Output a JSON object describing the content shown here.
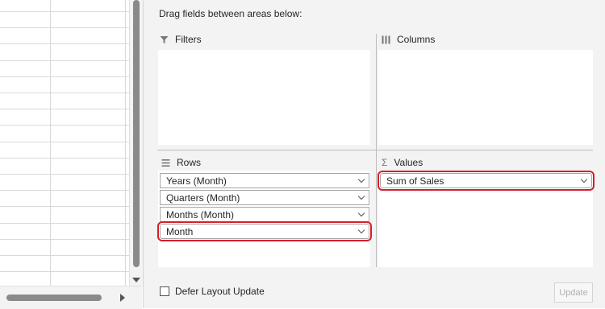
{
  "pane": {
    "instructions": "Drag fields between areas below:",
    "areas": {
      "filters": {
        "label": "Filters",
        "icon": "filter-icon"
      },
      "columns": {
        "label": "Columns",
        "icon": "columns-icon"
      },
      "rows": {
        "label": "Rows",
        "icon": "rows-icon",
        "fields": [
          "Years (Month)",
          "Quarters (Month)",
          "Months (Month)",
          "Month"
        ]
      },
      "values": {
        "label": "Values",
        "icon": "sigma-icon",
        "fields": [
          "Sum of Sales"
        ]
      }
    },
    "defer_label": "Defer Layout Update",
    "defer_checked": false,
    "update_label": "Update",
    "highlight_color": "#d61f2b"
  }
}
